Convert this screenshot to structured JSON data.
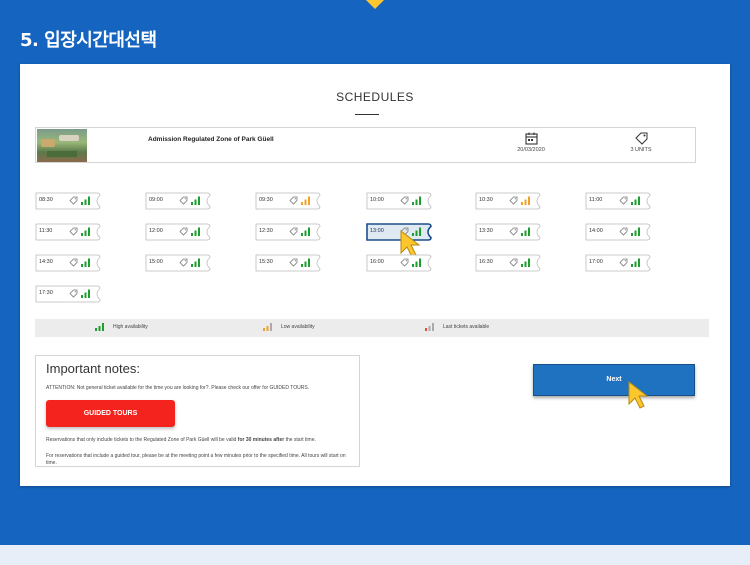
{
  "section_title": "5. 입장시간대선택",
  "schedules": {
    "title": "SCHEDULES",
    "product_name": "Admission Regulated Zone of Park Güell",
    "date": "20/03/2020",
    "units": "3 UNITS",
    "slots": [
      {
        "time": "08:30",
        "availability": "high"
      },
      {
        "time": "09:00",
        "availability": "high"
      },
      {
        "time": "09:30",
        "availability": "medium"
      },
      {
        "time": "10:00",
        "availability": "high"
      },
      {
        "time": "10:30",
        "availability": "medium"
      },
      {
        "time": "11:00",
        "availability": "high"
      },
      {
        "time": "11:30",
        "availability": "high"
      },
      {
        "time": "12:00",
        "availability": "high"
      },
      {
        "time": "12:30",
        "availability": "high"
      },
      {
        "time": "13:00",
        "availability": "high",
        "selected": true
      },
      {
        "time": "13:30",
        "availability": "high"
      },
      {
        "time": "14:00",
        "availability": "high"
      },
      {
        "time": "14:30",
        "availability": "high"
      },
      {
        "time": "15:00",
        "availability": "high"
      },
      {
        "time": "15:30",
        "availability": "high"
      },
      {
        "time": "16:00",
        "availability": "high"
      },
      {
        "time": "16:30",
        "availability": "high"
      },
      {
        "time": "17:00",
        "availability": "high"
      },
      {
        "time": "17:30",
        "availability": "high"
      }
    ]
  },
  "legend": {
    "high": "High availability",
    "medium": "Low availability",
    "low": "Last tickets available"
  },
  "notes": {
    "title": "Important notes:",
    "attention": "ATTENTION: Not general ticket available for the time you are looking for?. Please check our offer for GUIDED TOURS.",
    "guided_tours_label": "GUIDED TOURS",
    "p1_before": "Reservations that only include tickets to the Regulated Zone of Park Güell will be valid ",
    "p1_bold": "for 30 minutes after",
    "p1_after": " the start time.",
    "p2": "For reservations that include a guided tour, please be at the meeting point a few minutes prior to the specified time. All tours will start on time."
  },
  "next_label": "Next",
  "colors": {
    "page_bg": "#1565c0",
    "accent_yellow": "#fdc62d",
    "high_green": "#1e9e2e",
    "medium_orange": "#f2a02c",
    "low_red": "#e84a3c",
    "selected_slot_bg": "#dfeaf3",
    "selected_slot_border": "#1a4f8a",
    "guided_red": "#f5231e",
    "next_blue": "#1e72c0"
  },
  "icons": [
    "calendar-icon",
    "ticket-tag-icon",
    "signal-bars-icon",
    "cursor-arrow-icon"
  ]
}
